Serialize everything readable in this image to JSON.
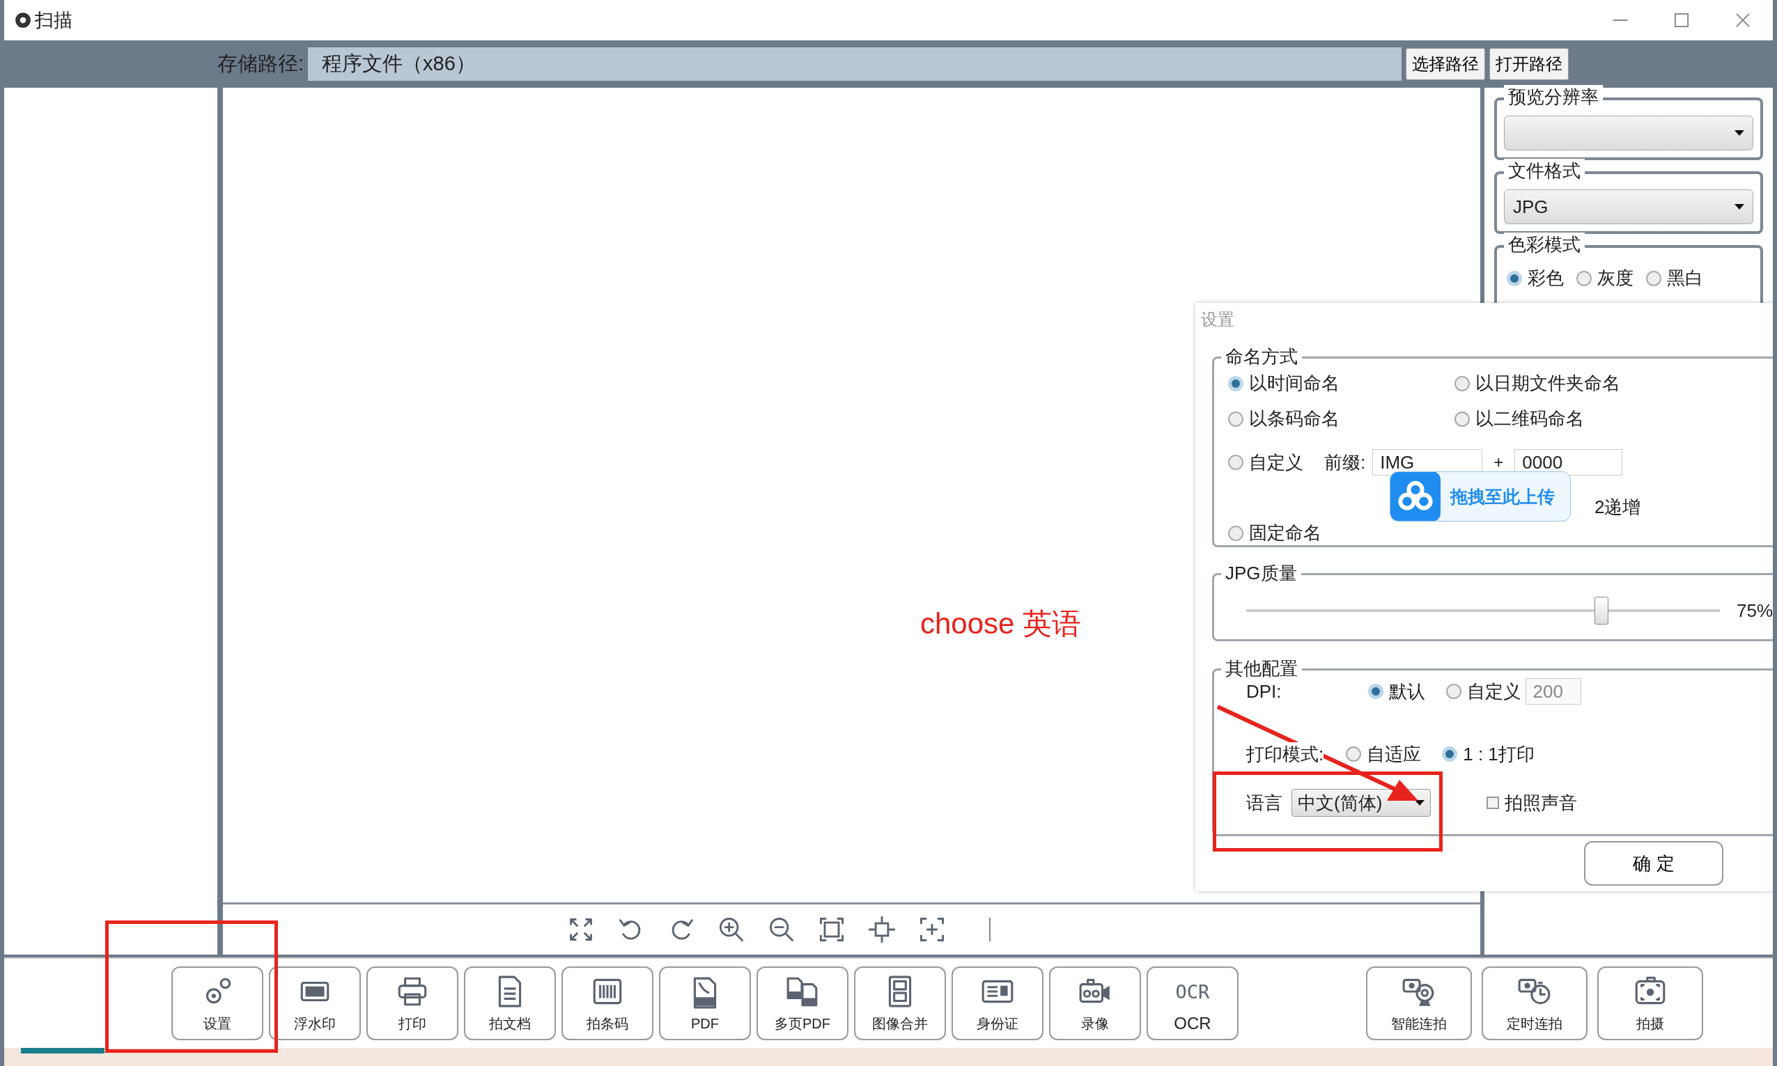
{
  "window": {
    "title": "扫描"
  },
  "path_bar": {
    "label": "存储路径:",
    "value": "程序文件（x86）",
    "buttons": [
      "选择路径",
      "打开路径"
    ]
  },
  "right_panel": {
    "groups": [
      {
        "title": "预览分辨率",
        "kind": "combo"
      },
      {
        "title": "文件格式",
        "kind": "combo",
        "value": "JPG"
      },
      {
        "title": "色彩模式",
        "kind": "radios",
        "options": [
          {
            "label": "彩色",
            "selected": true
          },
          {
            "label": "灰度",
            "selected": false
          },
          {
            "label": "黑白",
            "selected": false
          }
        ]
      }
    ]
  },
  "toolbar": {
    "left": [
      {
        "label": "设置",
        "kind": "gear"
      },
      {
        "label": "浮水印",
        "kind": "watermark"
      },
      {
        "label": "打印",
        "kind": "printer"
      },
      {
        "label": "拍文档",
        "kind": "document"
      },
      {
        "label": "拍条码",
        "kind": "barcode"
      },
      {
        "label": "PDF",
        "kind": "pdf"
      },
      {
        "label": "多页PDF",
        "kind": "multipdf"
      },
      {
        "label": "图像合并",
        "kind": "merge"
      },
      {
        "label": "身份证",
        "kind": "idcard"
      },
      {
        "label": "录像",
        "kind": "video"
      },
      {
        "label": "OCR",
        "kind": "ocr",
        "icon_text": "OCR"
      }
    ],
    "right": [
      {
        "label": "智能连拍",
        "kind": "smart"
      },
      {
        "label": "定时连拍",
        "kind": "timer"
      },
      {
        "label": "拍摄",
        "kind": "camera"
      }
    ]
  },
  "dialog": {
    "title": "设置",
    "naming": {
      "title": "命名方式",
      "options": [
        {
          "label": "以时间命名",
          "selected": true
        },
        {
          "label": "以日期文件夹命名",
          "selected": false
        },
        {
          "label": "以条码命名",
          "selected": false
        },
        {
          "label": "以二维码命名",
          "selected": false
        }
      ],
      "custom": {
        "label": "自定义",
        "selected": false
      },
      "prefix_label": "前缀:",
      "prefix_value": "IMG",
      "plus": "+",
      "counter_value": "0000",
      "step_text": "2递增",
      "fixed": {
        "label": "固定命名",
        "selected": false
      }
    },
    "quality": {
      "title": "JPG质量",
      "level": 0.75,
      "reading": "75%"
    },
    "other": {
      "title": "其他配置",
      "dpi": {
        "label": "DPI:",
        "options": [
          {
            "label": "默认",
            "selected": true
          },
          {
            "label": "自定义",
            "selected": false
          }
        ],
        "custom_value": "200"
      },
      "print_mode": {
        "label": "打印模式:",
        "options": [
          {
            "label": "自适应",
            "selected": false
          },
          {
            "label": "1 : 1打印",
            "selected": true
          }
        ]
      },
      "language": {
        "label": "语言",
        "value": "中文(简体)"
      },
      "shutter_sound": {
        "label": "拍照声音",
        "checked": false
      }
    },
    "ok_button": "确 定"
  },
  "upload_popup": {
    "label": "拖拽至此上传"
  },
  "annotation": {
    "text": "choose 英语"
  }
}
